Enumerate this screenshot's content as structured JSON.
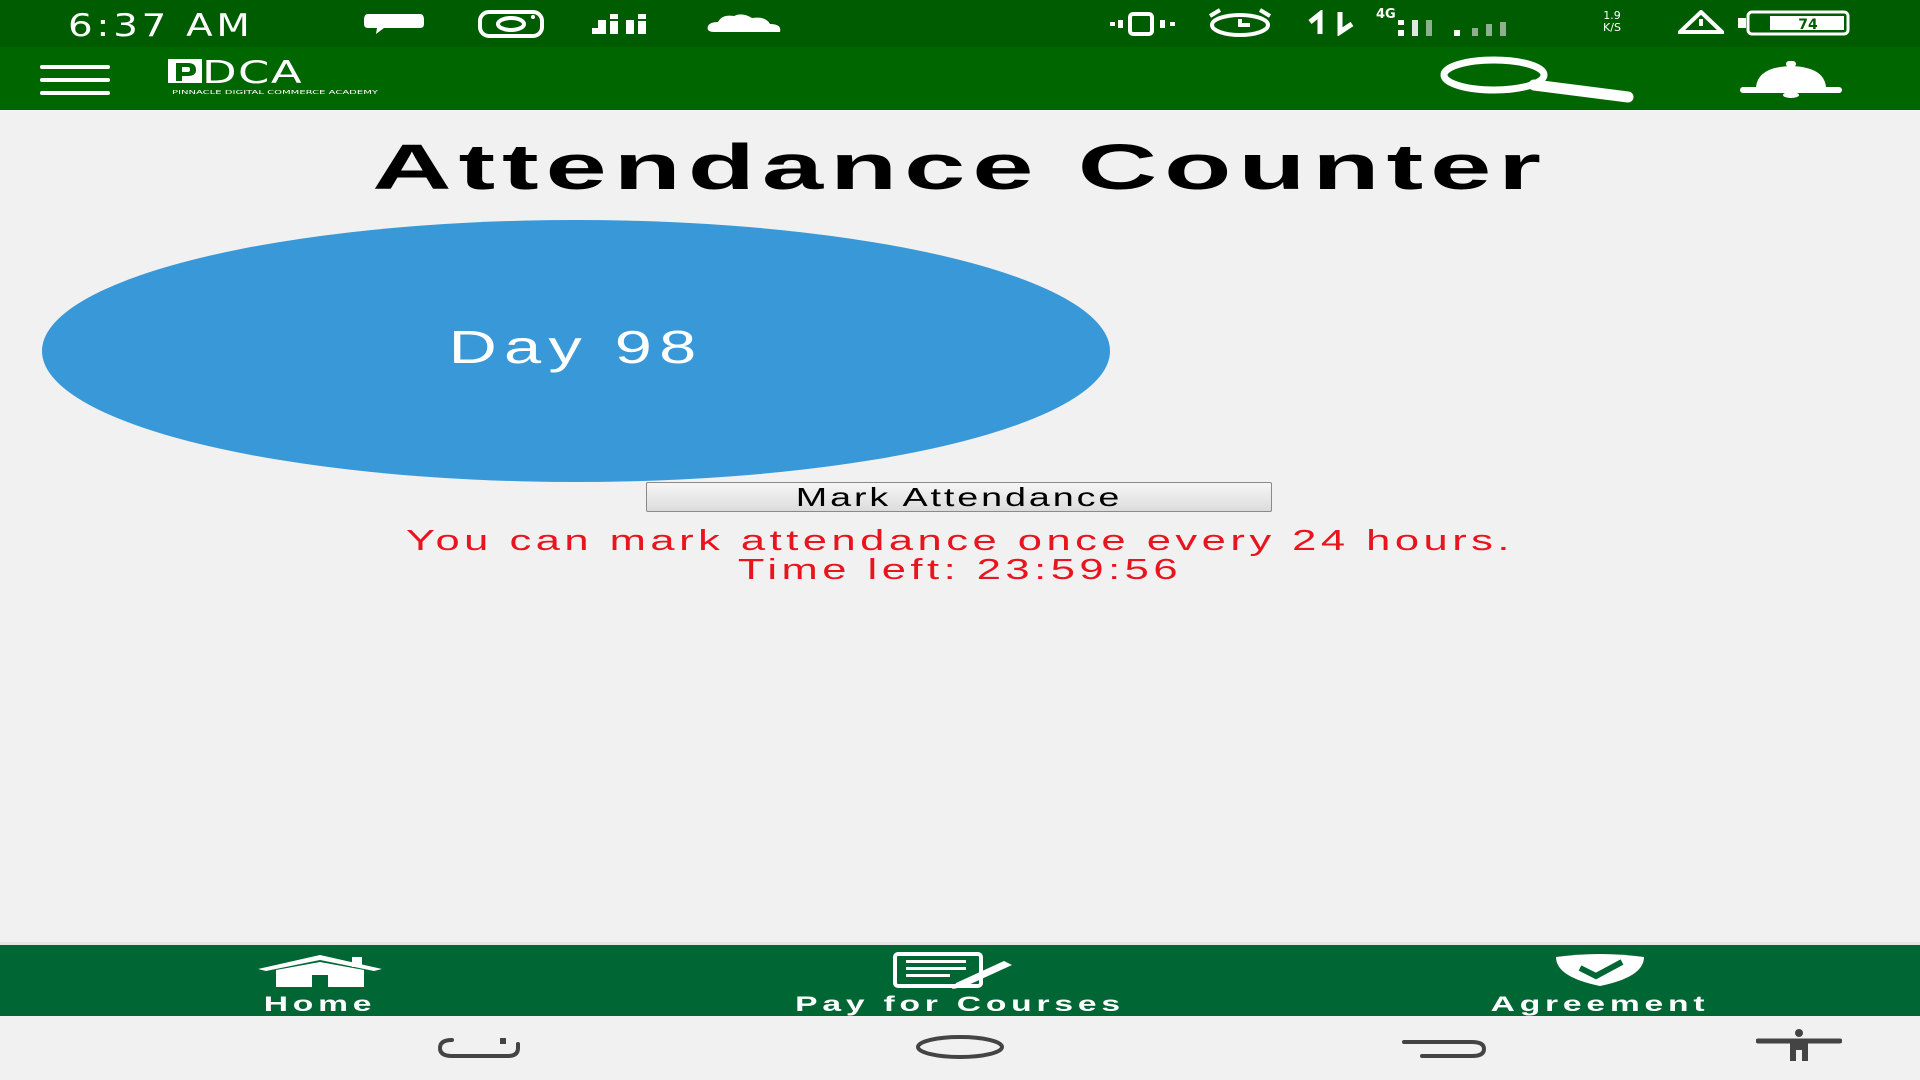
{
  "status_bar": {
    "time": "6:37 AM",
    "network": "4G",
    "speed_value": "1.9",
    "speed_unit": "K/S",
    "battery": "74",
    "icons": [
      "chat-icon",
      "instagram-icon",
      "jiji-icon",
      "cloud-icon",
      "vibrate-icon",
      "alarm-icon",
      "data-transfer-icon",
      "signal-icon",
      "warning-icon",
      "battery-icon"
    ]
  },
  "app_bar": {
    "logo_text": "DCA",
    "logo_tagline": "PINNACLE DIGITAL COMMERCE ACADEMY",
    "colors": {
      "background": "#006600",
      "status": "#005c00"
    }
  },
  "main": {
    "title": "Attendance Counter",
    "day_label": "Day 98",
    "mark_button_label": "Mark Attendance",
    "notice_line1": "You can mark attendance once every 24 hours.",
    "notice_line2": "Time left: 23:59:56",
    "colors": {
      "ellipse": "#3898d8",
      "notice": "#e8141e"
    }
  },
  "bottom_nav": {
    "items": [
      {
        "label": "Home",
        "icon": "home-icon"
      },
      {
        "label": "Pay for Courses",
        "icon": "edit-document-icon"
      },
      {
        "label": "Agreement",
        "icon": "shield-check-icon"
      }
    ],
    "color": "#006633"
  },
  "system_nav": {
    "icons": [
      "recent-apps-icon",
      "home-circle-icon",
      "back-icon",
      "accessibility-icon"
    ]
  }
}
